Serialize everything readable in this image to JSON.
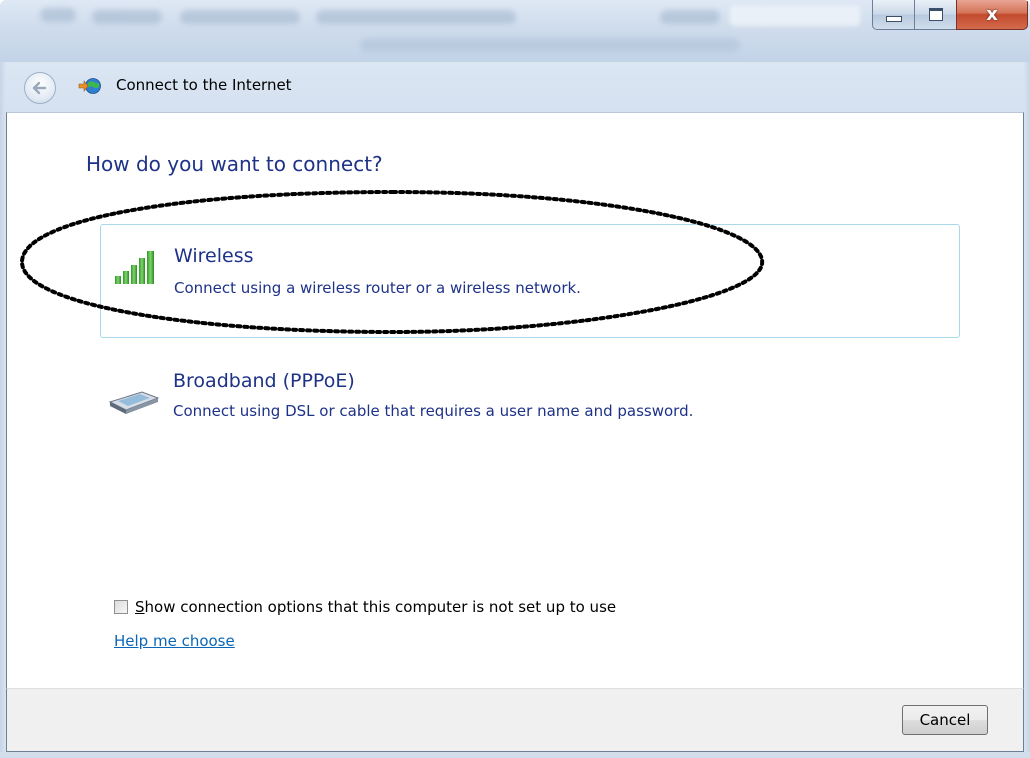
{
  "window": {
    "title": "Connect to the Internet",
    "close_glyph": "x"
  },
  "content": {
    "heading": "How do you want to connect?",
    "options": [
      {
        "icon": "wireless-signal-icon",
        "label": "Wireless",
        "description": "Connect using a wireless router or a wireless network.",
        "selected": true
      },
      {
        "icon": "broadband-modem-icon",
        "label": "Broadband (PPPoE)",
        "description": "Connect using DSL or cable that requires a user name and password.",
        "selected": false
      }
    ],
    "show_options_checkbox": {
      "label_mnemonic": "S",
      "label_rest": "how connection options that this computer is not set up to use",
      "checked": false
    },
    "help_link": "Help me choose"
  },
  "footer": {
    "cancel_label": "Cancel"
  },
  "colors": {
    "heading_blue": "#1e3287",
    "link_blue": "#0b66b8",
    "selection_border": "#a8d8ea"
  }
}
